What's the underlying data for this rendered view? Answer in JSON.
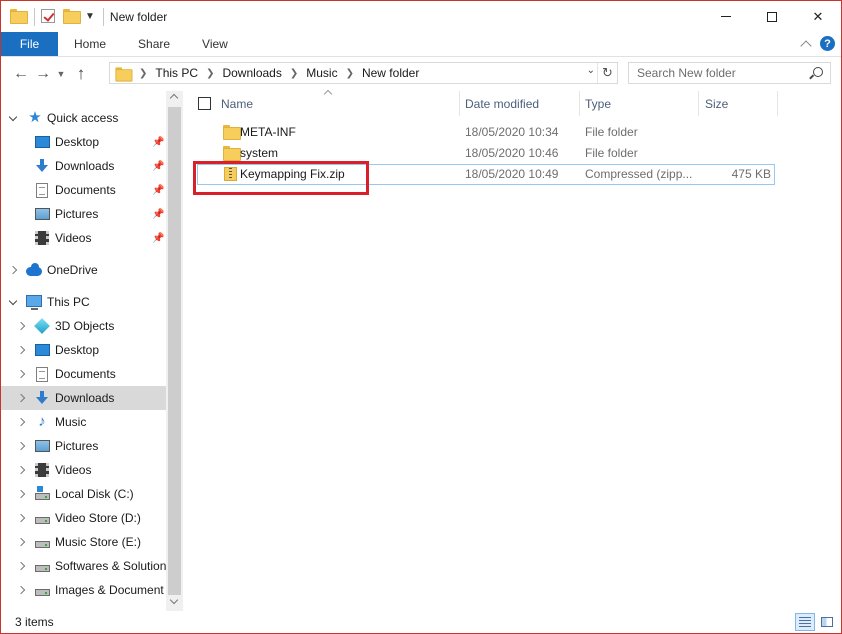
{
  "window": {
    "title": "New folder"
  },
  "ribbon": {
    "tabs": [
      {
        "label": "File"
      },
      {
        "label": "Home"
      },
      {
        "label": "Share"
      },
      {
        "label": "View"
      }
    ]
  },
  "address": {
    "crumbs": [
      "This PC",
      "Downloads",
      "Music",
      "New folder"
    ],
    "search_placeholder": "Search New folder"
  },
  "nav": {
    "quick_access": "Quick access",
    "pinned": [
      {
        "label": "Desktop",
        "icon": "desktop-icon"
      },
      {
        "label": "Downloads",
        "icon": "downloads-icon"
      },
      {
        "label": "Documents",
        "icon": "documents-icon"
      },
      {
        "label": "Pictures",
        "icon": "pictures-icon"
      },
      {
        "label": "Videos",
        "icon": "videos-icon"
      }
    ],
    "onedrive": "OneDrive",
    "this_pc": "This PC",
    "pc_items": [
      {
        "label": "3D Objects",
        "icon": "3d-objects-icon"
      },
      {
        "label": "Desktop",
        "icon": "desktop-icon"
      },
      {
        "label": "Documents",
        "icon": "documents-icon"
      },
      {
        "label": "Downloads",
        "icon": "downloads-icon",
        "selected": true
      },
      {
        "label": "Music",
        "icon": "music-icon"
      },
      {
        "label": "Pictures",
        "icon": "pictures-icon"
      },
      {
        "label": "Videos",
        "icon": "videos-icon"
      },
      {
        "label": "Local Disk (C:)",
        "icon": "local-disk-icon"
      },
      {
        "label": "Video Store (D:)",
        "icon": "drive-icon"
      },
      {
        "label": "Music Store (E:)",
        "icon": "drive-icon"
      },
      {
        "label": "Softwares & Solution",
        "icon": "drive-icon"
      },
      {
        "label": "Images & Document",
        "icon": "drive-icon"
      }
    ]
  },
  "columns": {
    "name": "Name",
    "date": "Date modified",
    "type": "Type",
    "size": "Size"
  },
  "files": [
    {
      "name": "META-INF",
      "date": "18/05/2020 10:34",
      "type": "File folder",
      "size": "",
      "icon": "folder-icon"
    },
    {
      "name": "system",
      "date": "18/05/2020 10:46",
      "type": "File folder",
      "size": "",
      "icon": "folder-icon"
    },
    {
      "name": "Keymapping Fix.zip",
      "date": "18/05/2020 10:49",
      "type": "Compressed (zipp...",
      "size": "475 KB",
      "icon": "zip-icon"
    }
  ],
  "status": {
    "count": "3 items"
  },
  "colors": {
    "accent": "#1a6fc1",
    "highlight_box": "#d9202a",
    "selected_nav": "#d9d9d9"
  }
}
